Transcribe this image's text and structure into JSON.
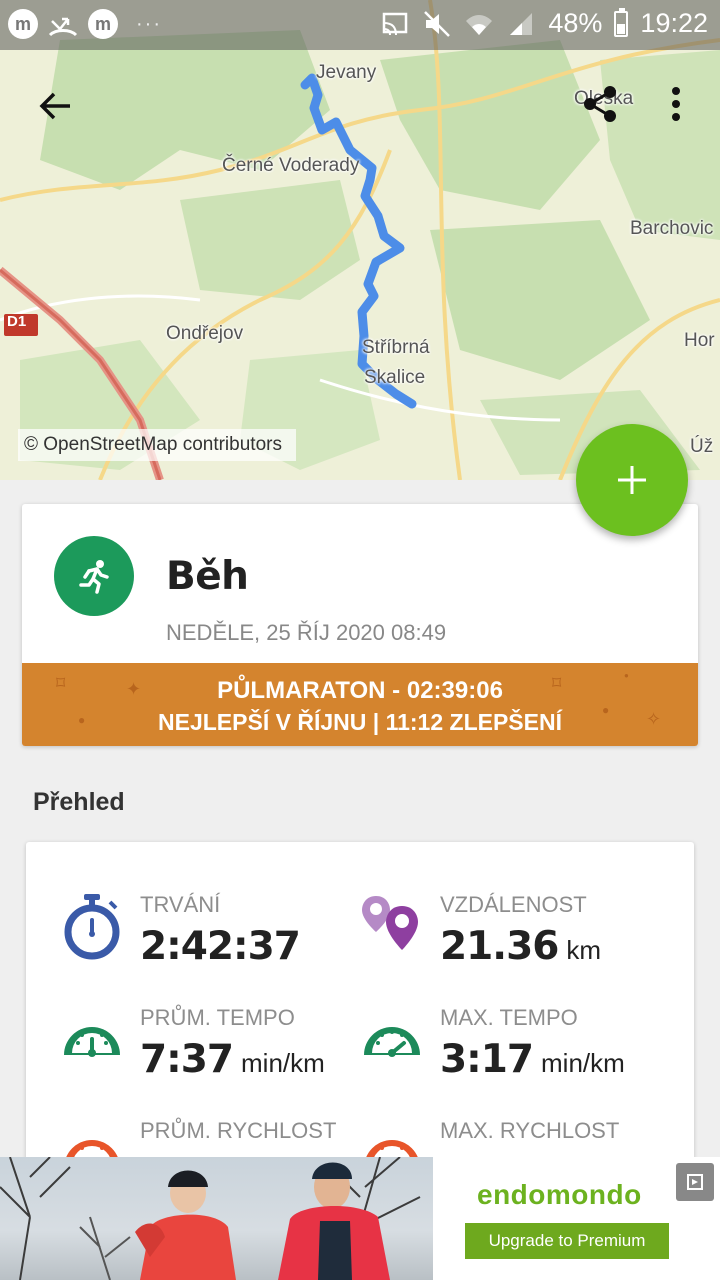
{
  "status_bar": {
    "left_icons": [
      "m",
      "m"
    ],
    "dots": "···",
    "battery": "48%",
    "time": "19:22"
  },
  "map": {
    "places": {
      "levany": "Jevany",
      "oleska": "Oleška",
      "cerne_voderady": "Černé Voderady",
      "barchovice": "Barchovic",
      "ondrejov": "Ondřejov",
      "stribrna": "Stříbrná",
      "skalice": "Skalice",
      "hor": "Hor",
      "uz": "Úž",
      "d1": "D1"
    },
    "attribution": "© OpenStreetMap contributors",
    "route_color": "#4d8de8"
  },
  "workout": {
    "sport": "Běh",
    "date": "NEDĚLE, 25 ŘÍJ 2020 08:49",
    "record_line1": "PŮLMARATON  -  02:39:06",
    "record_line2": "NEJLEPŠÍ V ŘÍJNU  |  11:12 ZLEPŠENÍ"
  },
  "overview": {
    "title": "Přehled",
    "duration": {
      "label": "TRVÁNÍ",
      "value": "2:42:37"
    },
    "distance": {
      "label": "VZDÁLENOST",
      "value": "21.36",
      "unit": "km"
    },
    "avg_pace": {
      "label": "PRŮM. TEMPO",
      "value": "7:37",
      "unit": "min/km"
    },
    "max_pace": {
      "label": "MAX. TEMPO",
      "value": "3:17",
      "unit": "min/km"
    },
    "avg_speed": {
      "label": "PRŮM. RYCHLOST"
    },
    "max_speed": {
      "label": "MAX. RYCHLOST"
    }
  },
  "ad": {
    "brand": "endomondo",
    "button": "Upgrade to Premium"
  },
  "colors": {
    "accent_green": "#6cc01f",
    "run_icon_bg": "#1c9a5b",
    "record_banner": "#d4842e",
    "duration_icon": "#3a5aa8",
    "distance_icon": "#8e3fa0",
    "pace_icon": "#1c8a5a",
    "speed_icon": "#e8552a"
  }
}
